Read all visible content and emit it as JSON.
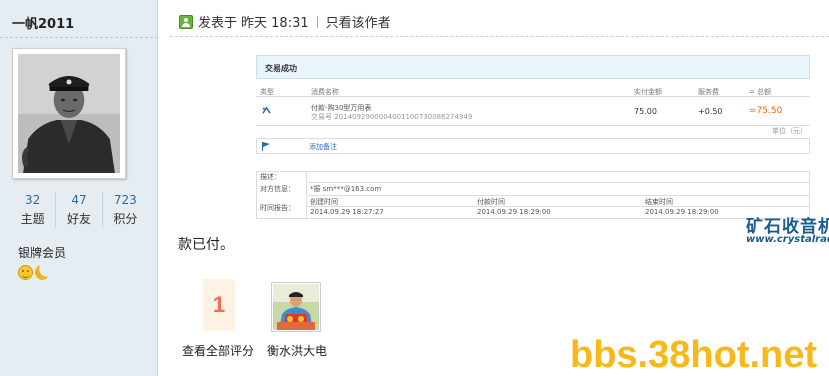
{
  "user": {
    "name": "一帆2011",
    "stats": [
      {
        "value": "32",
        "label": "主题"
      },
      {
        "value": "47",
        "label": "好友"
      },
      {
        "value": "723",
        "label": "积分"
      }
    ],
    "rank": "银牌会员"
  },
  "post": {
    "posted_label": "发表于",
    "posted_time": "昨天 18:31",
    "only_author": "只看该作者",
    "text": "款已付。"
  },
  "receipt": {
    "title": "交易成功",
    "columns": {
      "type": "类型",
      "name": "消费名称",
      "paid": "实付金额",
      "fee": "服务费",
      "total": "= 总额"
    },
    "item": {
      "name": "付款-购30型万用表",
      "trade_no": "交易号 2014092900004001100730086274949",
      "paid": "75.00",
      "fee": "+0.50",
      "total": "=75.50"
    },
    "unit": "单位（元）",
    "add_note": "添加备注",
    "info": {
      "desc_label": "描述：",
      "party_label": "对方信息：",
      "party_value": "*振 sm***@163.com",
      "time_label": "时间报告：",
      "created_label": "创建时间",
      "created_value": "2014.09.29 18:27:27",
      "paid_label": "付款时间",
      "paid_value": "2014.09.29 18:29:00",
      "finished_label": "结束时间",
      "finished_value": "2014.09.29 18:29:00"
    }
  },
  "rating": {
    "count": "1",
    "view_all": "查看全部评分",
    "rater": "衡水洪大电"
  },
  "watermarks": {
    "site_cn": "矿石收音机",
    "site_url": "www.crystalradio.cn",
    "bbs": "bbs.38hot.net"
  }
}
